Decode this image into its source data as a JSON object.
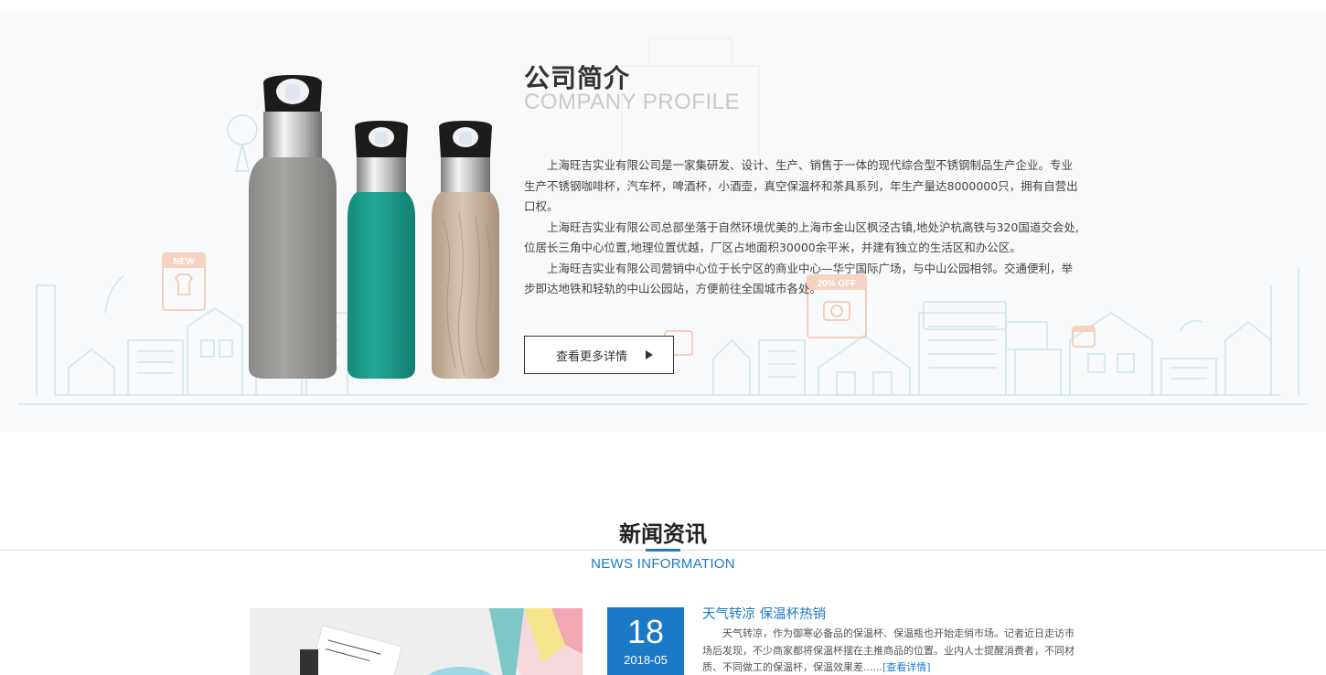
{
  "profile": {
    "title": "公司简介",
    "subtitle": "COMPANY PROFILE",
    "paragraphs": [
      "上海旺吉实业有限公司是一家集研发、设计、生产、销售于一体的现代综合型不锈钢制品生产企业。专业生产不锈钢咖啡杯，汽车杯，啤酒杯，小酒壶，真空保温杯和茶具系列，年生产量达8000000只，拥有自营出口权。",
      "上海旺吉实业有限公司总部坐落于自然环境优美的上海市金山区枫泾古镇,地处沪杭高铁与320国道交会处,位居长三角中心位置,地理位置优越，厂区占地面积30000余平米，并建有独立的生活区和办公区。",
      "上海旺吉实业有限公司营销中心位于长宁区的商业中心—华宁国际广场，与中山公园相邻。交通便利，举步即达地铁和轻轨的中山公园站，方便前往全国城市各处。"
    ],
    "more_label": "查看更多详情",
    "bottle_colors": [
      "#9a9895",
      "#1fa08f",
      "#c7b29d"
    ],
    "badges": {
      "new": "NEW",
      "off": "20% OFF"
    }
  },
  "news": {
    "title": "新闻资讯",
    "subtitle": "NEWS INFORMATION",
    "accent_color": "#1b7ac7",
    "item": {
      "day": "18",
      "year_month": "2018-05",
      "headline": "天气转凉 保温杯热销",
      "summary": "天气转凉，作为御寒必备品的保温杯、保温瓶也开始走俏市场。记者近日走访市场后发现，不少商家都将保温杯摆在主推商品的位置。业内人士提醒消费者，不同材质、不同做工的保温杯，保温效果差......",
      "more_link": "[查看详情]"
    }
  }
}
